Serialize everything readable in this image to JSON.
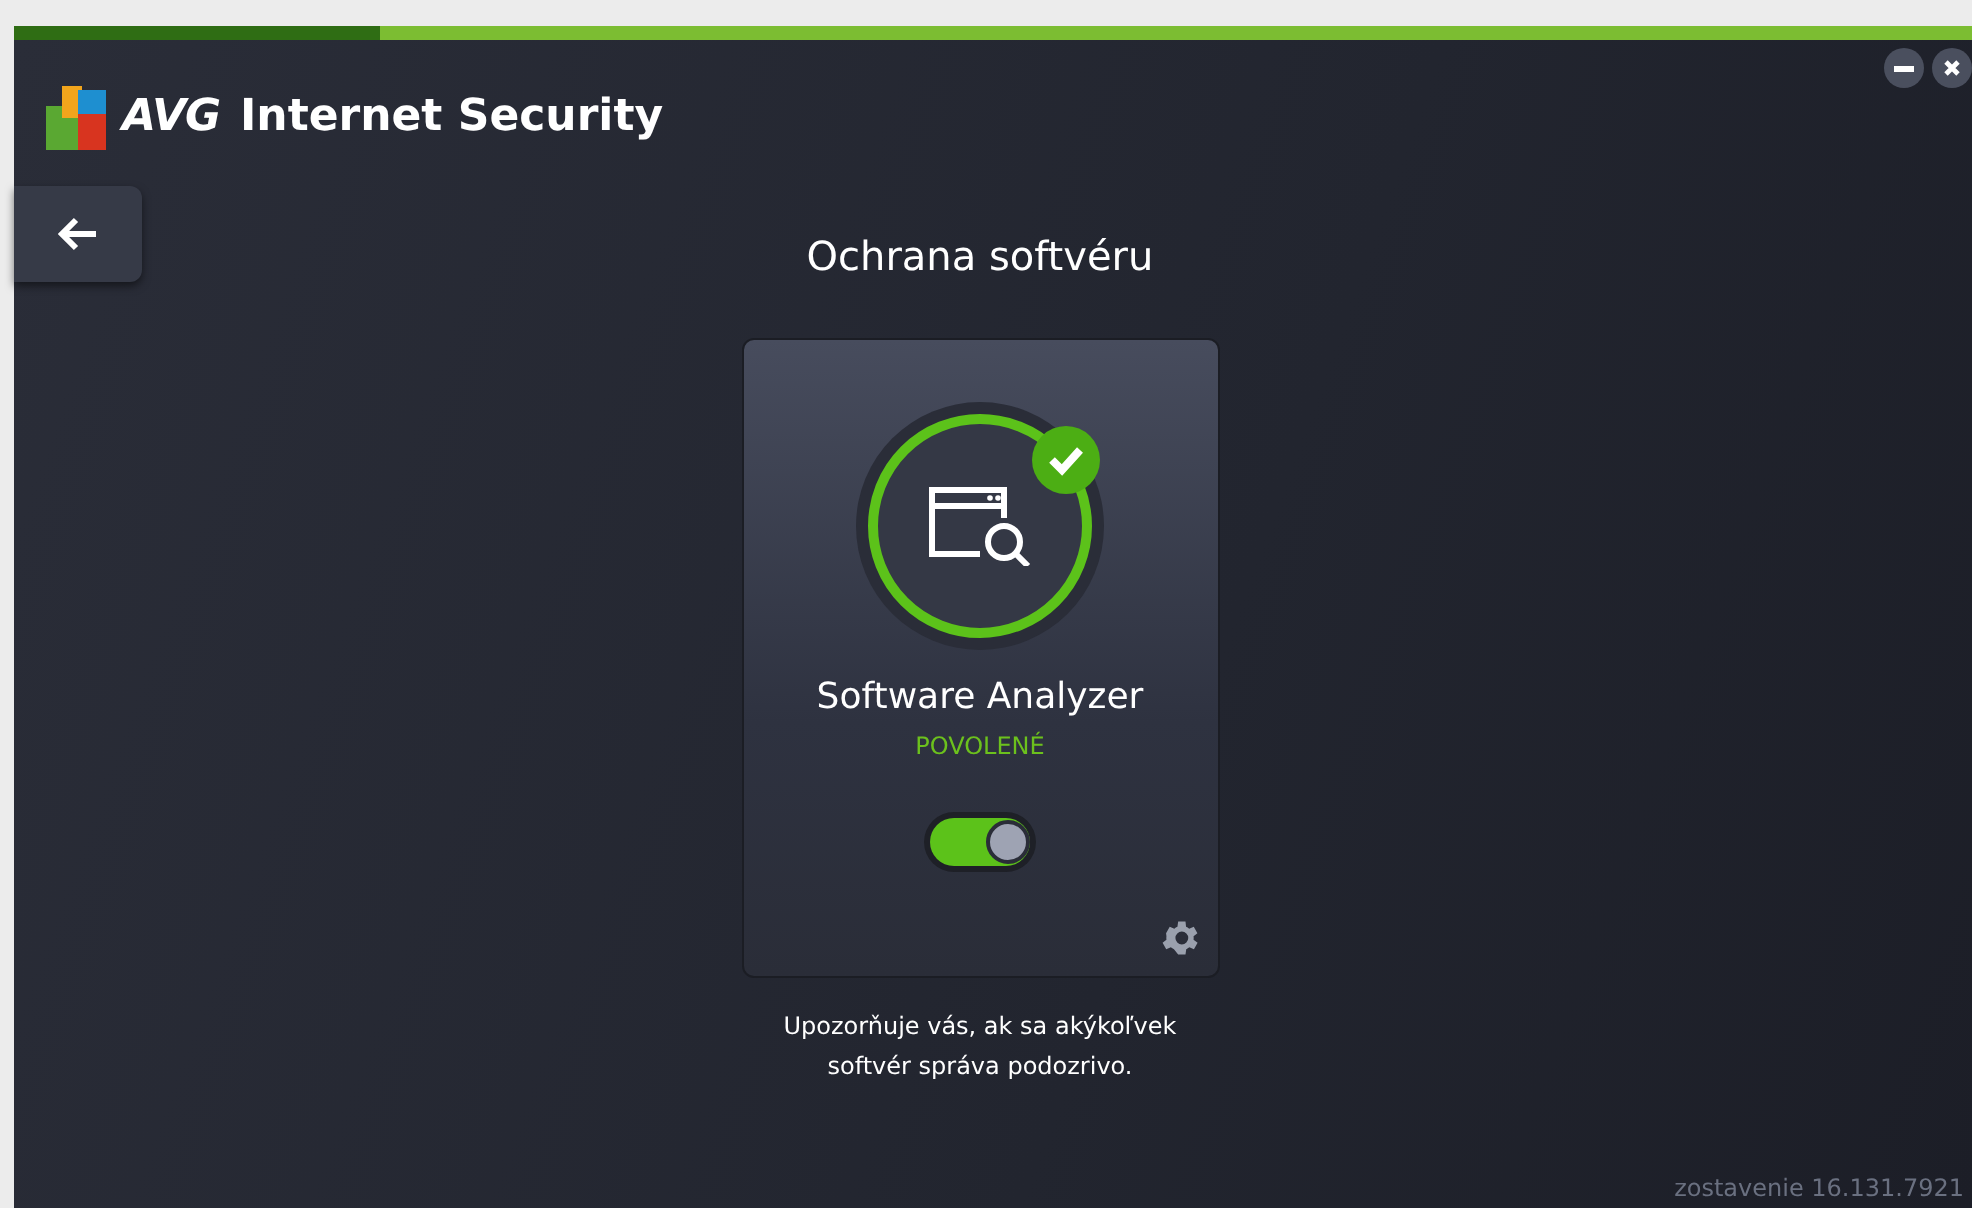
{
  "app": {
    "brand": "AVG",
    "title": "Internet Security"
  },
  "window_controls": [
    {
      "kind": "minimize"
    },
    {
      "kind": "close"
    }
  ],
  "page_title": "Ochrana softvéru",
  "card": {
    "name": "Software Analyzer",
    "status": "POVOLENÉ",
    "on": true
  },
  "description": "Upozorňuje vás, ak sa akýkoľvek softvér správa podozrivo.",
  "build": "zostavenie 16.131.7921"
}
